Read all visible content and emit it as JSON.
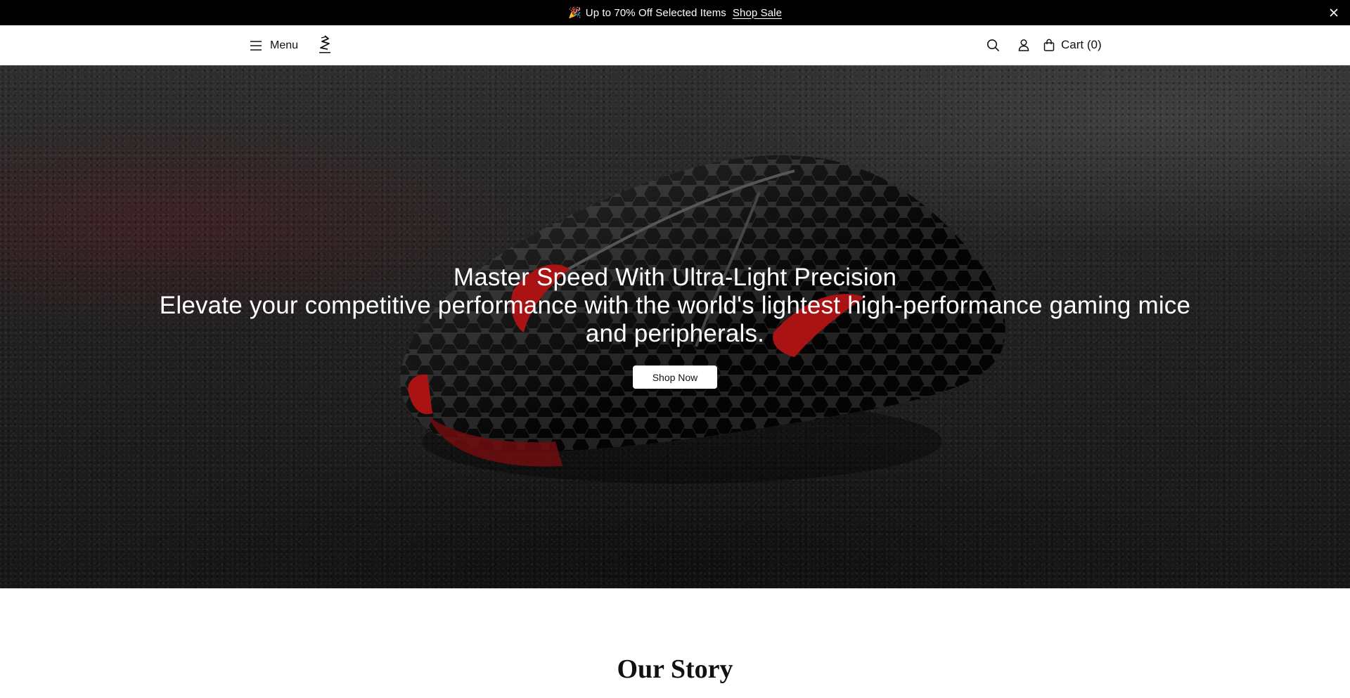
{
  "announcement": {
    "emoji": "🎉",
    "text": "Up to 70% Off Selected Items",
    "link_label": "Shop Sale",
    "close_icon": "close-icon"
  },
  "header": {
    "menu_label": "Menu",
    "menu_icon": "hamburger-icon",
    "logo_icon": "brand-logo",
    "search_icon": "search-icon",
    "account_icon": "user-icon",
    "cart_icon": "shopping-bag-icon",
    "cart_label": "Cart (0)"
  },
  "hero": {
    "title": "Master Speed With Ultra-Light Precision",
    "subtitle": "Elevate your competitive performance with the world's lightest high-performance gaming mice and peripherals.",
    "cta_label": "Shop Now"
  },
  "story": {
    "title": "Our Story"
  },
  "colors": {
    "announcement_bg": "#000000",
    "accent_red": "#d01818",
    "text_light": "#ffffff"
  }
}
